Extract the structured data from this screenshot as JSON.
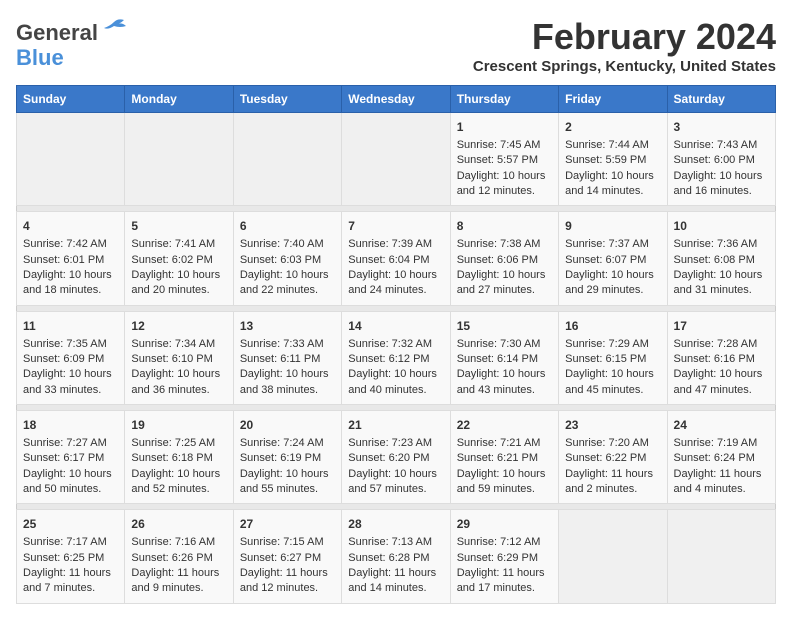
{
  "app": {
    "logo_line1": "General",
    "logo_line2": "Blue",
    "month": "February 2024",
    "location": "Crescent Springs, Kentucky, United States"
  },
  "calendar": {
    "days_of_week": [
      "Sunday",
      "Monday",
      "Tuesday",
      "Wednesday",
      "Thursday",
      "Friday",
      "Saturday"
    ],
    "weeks": [
      [
        {
          "day": "",
          "content": ""
        },
        {
          "day": "",
          "content": ""
        },
        {
          "day": "",
          "content": ""
        },
        {
          "day": "",
          "content": ""
        },
        {
          "day": "1",
          "content": "Sunrise: 7:45 AM\nSunset: 5:57 PM\nDaylight: 10 hours\nand 12 minutes."
        },
        {
          "day": "2",
          "content": "Sunrise: 7:44 AM\nSunset: 5:59 PM\nDaylight: 10 hours\nand 14 minutes."
        },
        {
          "day": "3",
          "content": "Sunrise: 7:43 AM\nSunset: 6:00 PM\nDaylight: 10 hours\nand 16 minutes."
        }
      ],
      [
        {
          "day": "4",
          "content": "Sunrise: 7:42 AM\nSunset: 6:01 PM\nDaylight: 10 hours\nand 18 minutes."
        },
        {
          "day": "5",
          "content": "Sunrise: 7:41 AM\nSunset: 6:02 PM\nDaylight: 10 hours\nand 20 minutes."
        },
        {
          "day": "6",
          "content": "Sunrise: 7:40 AM\nSunset: 6:03 PM\nDaylight: 10 hours\nand 22 minutes."
        },
        {
          "day": "7",
          "content": "Sunrise: 7:39 AM\nSunset: 6:04 PM\nDaylight: 10 hours\nand 24 minutes."
        },
        {
          "day": "8",
          "content": "Sunrise: 7:38 AM\nSunset: 6:06 PM\nDaylight: 10 hours\nand 27 minutes."
        },
        {
          "day": "9",
          "content": "Sunrise: 7:37 AM\nSunset: 6:07 PM\nDaylight: 10 hours\nand 29 minutes."
        },
        {
          "day": "10",
          "content": "Sunrise: 7:36 AM\nSunset: 6:08 PM\nDaylight: 10 hours\nand 31 minutes."
        }
      ],
      [
        {
          "day": "11",
          "content": "Sunrise: 7:35 AM\nSunset: 6:09 PM\nDaylight: 10 hours\nand 33 minutes."
        },
        {
          "day": "12",
          "content": "Sunrise: 7:34 AM\nSunset: 6:10 PM\nDaylight: 10 hours\nand 36 minutes."
        },
        {
          "day": "13",
          "content": "Sunrise: 7:33 AM\nSunset: 6:11 PM\nDaylight: 10 hours\nand 38 minutes."
        },
        {
          "day": "14",
          "content": "Sunrise: 7:32 AM\nSunset: 6:12 PM\nDaylight: 10 hours\nand 40 minutes."
        },
        {
          "day": "15",
          "content": "Sunrise: 7:30 AM\nSunset: 6:14 PM\nDaylight: 10 hours\nand 43 minutes."
        },
        {
          "day": "16",
          "content": "Sunrise: 7:29 AM\nSunset: 6:15 PM\nDaylight: 10 hours\nand 45 minutes."
        },
        {
          "day": "17",
          "content": "Sunrise: 7:28 AM\nSunset: 6:16 PM\nDaylight: 10 hours\nand 47 minutes."
        }
      ],
      [
        {
          "day": "18",
          "content": "Sunrise: 7:27 AM\nSunset: 6:17 PM\nDaylight: 10 hours\nand 50 minutes."
        },
        {
          "day": "19",
          "content": "Sunrise: 7:25 AM\nSunset: 6:18 PM\nDaylight: 10 hours\nand 52 minutes."
        },
        {
          "day": "20",
          "content": "Sunrise: 7:24 AM\nSunset: 6:19 PM\nDaylight: 10 hours\nand 55 minutes."
        },
        {
          "day": "21",
          "content": "Sunrise: 7:23 AM\nSunset: 6:20 PM\nDaylight: 10 hours\nand 57 minutes."
        },
        {
          "day": "22",
          "content": "Sunrise: 7:21 AM\nSunset: 6:21 PM\nDaylight: 10 hours\nand 59 minutes."
        },
        {
          "day": "23",
          "content": "Sunrise: 7:20 AM\nSunset: 6:22 PM\nDaylight: 11 hours\nand 2 minutes."
        },
        {
          "day": "24",
          "content": "Sunrise: 7:19 AM\nSunset: 6:24 PM\nDaylight: 11 hours\nand 4 minutes."
        }
      ],
      [
        {
          "day": "25",
          "content": "Sunrise: 7:17 AM\nSunset: 6:25 PM\nDaylight: 11 hours\nand 7 minutes."
        },
        {
          "day": "26",
          "content": "Sunrise: 7:16 AM\nSunset: 6:26 PM\nDaylight: 11 hours\nand 9 minutes."
        },
        {
          "day": "27",
          "content": "Sunrise: 7:15 AM\nSunset: 6:27 PM\nDaylight: 11 hours\nand 12 minutes."
        },
        {
          "day": "28",
          "content": "Sunrise: 7:13 AM\nSunset: 6:28 PM\nDaylight: 11 hours\nand 14 minutes."
        },
        {
          "day": "29",
          "content": "Sunrise: 7:12 AM\nSunset: 6:29 PM\nDaylight: 11 hours\nand 17 minutes."
        },
        {
          "day": "",
          "content": ""
        },
        {
          "day": "",
          "content": ""
        }
      ]
    ]
  }
}
